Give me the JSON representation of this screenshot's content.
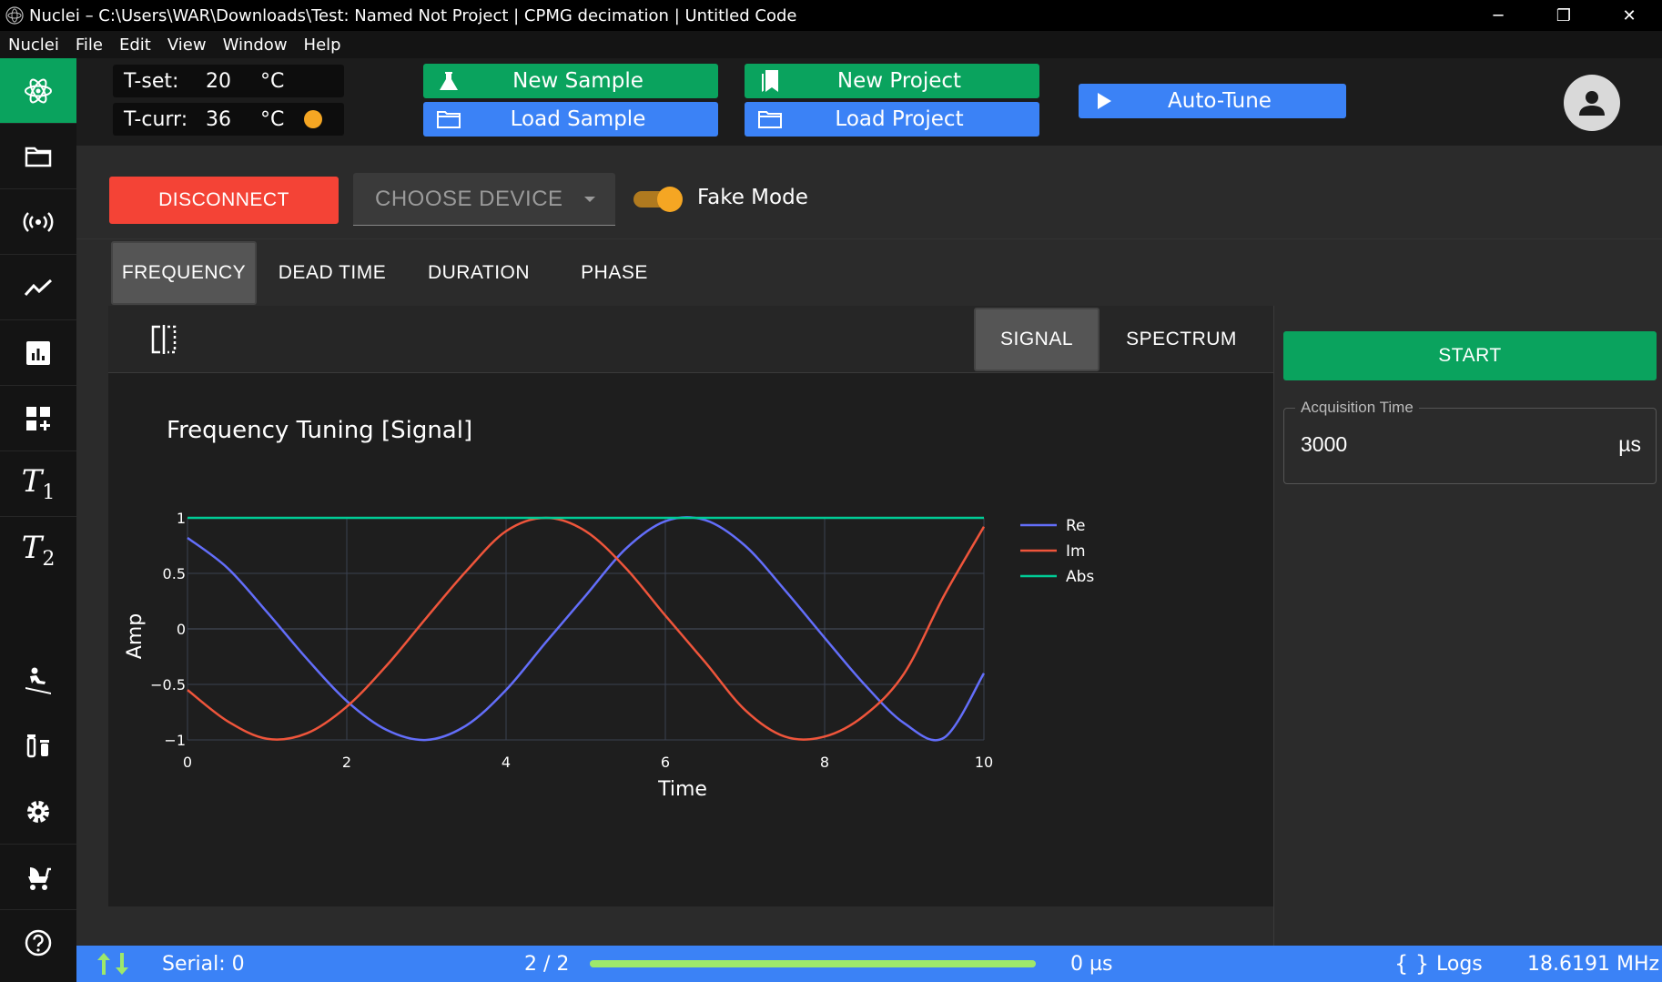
{
  "window": {
    "title": "Nuclei – C:\\Users\\WAR\\Downloads\\Test: Named Not Project | CPMG decimation | Untitled Code",
    "controls": [
      "─",
      "❐",
      "✕"
    ]
  },
  "menu": [
    "Nuclei",
    "File",
    "Edit",
    "View",
    "Window",
    "Help"
  ],
  "sidebar": {
    "items": [
      {
        "name": "atom-icon",
        "active": true
      },
      {
        "name": "folder-icon"
      },
      {
        "name": "broadcast-icon"
      },
      {
        "name": "line-chart-icon"
      },
      {
        "name": "bar-chart-icon"
      },
      {
        "name": "dashboard-add-icon"
      },
      {
        "name": "t1-icon",
        "label": "T",
        "sub": "1"
      },
      {
        "name": "t2-icon",
        "label": "T",
        "sub": "2"
      },
      {
        "name": "sledding-icon"
      },
      {
        "name": "vials-icon"
      },
      {
        "name": "gear-icon"
      },
      {
        "name": "stroller-icon"
      },
      {
        "name": "help-icon"
      }
    ]
  },
  "header": {
    "t_set": {
      "label": "T-set:",
      "value": "20",
      "unit": "°C"
    },
    "t_curr": {
      "label": "T-curr:",
      "value": "36",
      "unit": "°C",
      "indicator_color": "#f5a623"
    },
    "new_sample": "New Sample",
    "load_sample": "Load Sample",
    "new_project": "New Project",
    "load_project": "Load Project",
    "auto_tune": "Auto-Tune"
  },
  "device": {
    "disconnect": "DISCONNECT",
    "choose_device": "CHOOSE DEVICE",
    "fake_mode_label": "Fake Mode",
    "fake_mode_on": true
  },
  "tabs": [
    "FREQUENCY",
    "DEAD TIME",
    "DURATION",
    "PHASE"
  ],
  "active_tab": "FREQUENCY",
  "plot_tabs": [
    "SIGNAL",
    "SPECTRUM"
  ],
  "active_plot_tab": "SIGNAL",
  "right_panel": {
    "start": "START",
    "acq_label": "Acquisition Time",
    "acq_value": "3000",
    "acq_unit": "µs"
  },
  "status": {
    "serial": "Serial: 0",
    "progress_text": "2 / 2",
    "progress": 1.0,
    "time": "0 µs",
    "logs": "Logs",
    "freq": "18.6191 MHz"
  },
  "colors": {
    "accent_green": "#0aa35e",
    "accent_blue": "#3b82f6",
    "danger": "#f44336",
    "re": "#636efa",
    "im": "#ef553b",
    "abs": "#00cc96"
  },
  "chart_data": {
    "type": "line",
    "title": "Frequency Tuning [Signal]",
    "xlabel": "Time",
    "ylabel": "Amp",
    "xlim": [
      0,
      10
    ],
    "ylim": [
      -1,
      1
    ],
    "x_ticks": [
      0,
      2,
      4,
      6,
      8,
      10
    ],
    "y_ticks": [
      1,
      0.5,
      0,
      -0.5,
      -1
    ],
    "y_tick_labels": [
      "1",
      "0.5",
      "0",
      "−0.5",
      "−1"
    ],
    "grid": true,
    "legend": "right",
    "series": [
      {
        "name": "Re",
        "x": [
          0,
          0.5,
          1,
          1.5,
          2,
          2.5,
          3,
          3.5,
          4,
          4.5,
          5,
          5.5,
          6,
          6.5,
          7,
          7.5,
          8,
          8.5,
          9,
          9.5,
          10
        ],
        "values": [
          0.82,
          0.55,
          0.15,
          -0.27,
          -0.65,
          -0.91,
          -1.0,
          -0.87,
          -0.55,
          -0.12,
          0.3,
          0.72,
          0.97,
          0.98,
          0.75,
          0.35,
          -0.08,
          -0.5,
          -0.85,
          -0.98,
          -0.4
        ]
      },
      {
        "name": "Im",
        "x": [
          0,
          0.5,
          1,
          1.5,
          2,
          2.5,
          3,
          3.5,
          4,
          4.5,
          5,
          5.5,
          6,
          6.5,
          7,
          7.5,
          8,
          8.5,
          9,
          9.5,
          10
        ],
        "values": [
          -0.55,
          -0.83,
          -0.99,
          -0.94,
          -0.7,
          -0.33,
          0.1,
          0.52,
          0.88,
          1.0,
          0.88,
          0.55,
          0.12,
          -0.3,
          -0.73,
          -0.97,
          -0.97,
          -0.78,
          -0.4,
          0.3,
          0.92
        ]
      },
      {
        "name": "Abs",
        "x": [
          0,
          10
        ],
        "values": [
          1,
          1
        ]
      }
    ]
  }
}
